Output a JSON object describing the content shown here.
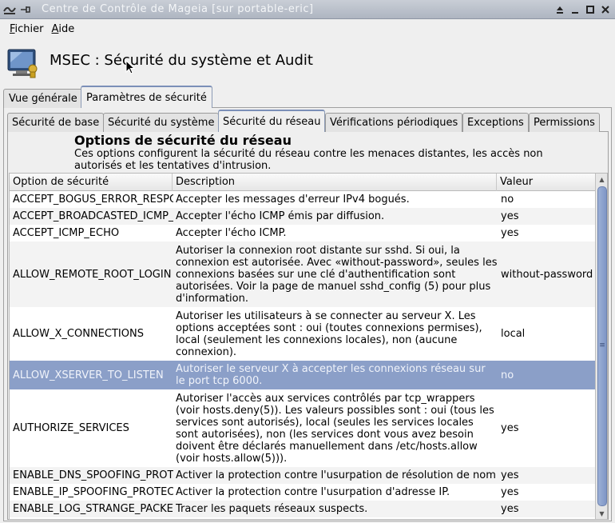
{
  "window": {
    "title": "Centre de Contrôle de Mageia  [sur portable-eric]",
    "left_icons": [
      "app-menu-icon",
      "pin-icon"
    ],
    "buttons": [
      "shade-icon",
      "minimize-icon",
      "maximize-icon",
      "close-icon"
    ]
  },
  "menu": {
    "file": "Fichier",
    "help": "Aide"
  },
  "header": {
    "title": "MSEC : Sécurité du système et Audit"
  },
  "outer_tabs": [
    "Vue générale",
    "Paramètres de sécurité"
  ],
  "inner_tabs": [
    "Sécurité de base",
    "Sécurité du système",
    "Sécurité du réseau",
    "Vérifications périodiques",
    "Exceptions",
    "Permissions"
  ],
  "section": {
    "title": "Options de sécurité du réseau",
    "description": "Ces options configurent la sécurité du réseau contre les menaces distantes, les accès non autorisés et les tentatives d'intrusion."
  },
  "table": {
    "columns": [
      "Option de sécurité",
      "Description",
      "Valeur"
    ],
    "rows": [
      {
        "option": "ACCEPT_BOGUS_ERROR_RESPONSES",
        "description": "Accepter les messages d'erreur IPv4 bogués.",
        "value": "no"
      },
      {
        "option": "ACCEPT_BROADCASTED_ICMP_ECHO",
        "description": "Accepter l'écho ICMP émis par diffusion.",
        "value": "yes"
      },
      {
        "option": "ACCEPT_ICMP_ECHO",
        "description": "Accepter l'écho ICMP.",
        "value": "yes"
      },
      {
        "option": "ALLOW_REMOTE_ROOT_LOGIN",
        "description": "Autoriser la connexion root distante sur sshd. Si oui, la connexion est autorisée. Avec «without-password», seules les connexions basées sur une clé d'authentification sont autorisées. Voir la page de manuel sshd_config (5) pour plus d'information.",
        "value": "without-password"
      },
      {
        "option": "ALLOW_X_CONNECTIONS",
        "description": "Autoriser les utilisateurs à se connecter au serveur X. Les options acceptées sont : oui (toutes connexions permises), local (seulement les connexions locales), non (aucune connexion).",
        "value": "local"
      },
      {
        "option": "ALLOW_XSERVER_TO_LISTEN",
        "description": "Autoriser le serveur X à accepter les connexions réseau sur le port tcp 6000.",
        "value": "no"
      },
      {
        "option": "AUTHORIZE_SERVICES",
        "description": "Autoriser l'accès aux services contrôlés par tcp_wrappers (voir hosts.deny(5)). Les valeurs possibles sont : oui (tous les services sont autorisés), local (seules les services locales sont autorisées), non (les services dont vous avez besoin doivent être déclarés manuellement dans /etc/hosts.allow (voir hosts.allow(5))).",
        "value": "yes"
      },
      {
        "option": "ENABLE_DNS_SPOOFING_PROTECTION",
        "description": "Activer la protection contre l'usurpation de résolution de nom",
        "value": "yes"
      },
      {
        "option": "ENABLE_IP_SPOOFING_PROTECTION",
        "description": "Activer la protection contre l'usurpation d'adresse IP.",
        "value": "yes"
      },
      {
        "option": "ENABLE_LOG_STRANGE_PACKETS",
        "description": "Tracer les paquets réseaux suspects.",
        "value": "yes"
      }
    ],
    "selected_index": 5
  },
  "colors": {
    "selection": "#8b9fc8",
    "titlebar": "#aeb5c1",
    "scroll_thumb": "#8ea3cf"
  }
}
